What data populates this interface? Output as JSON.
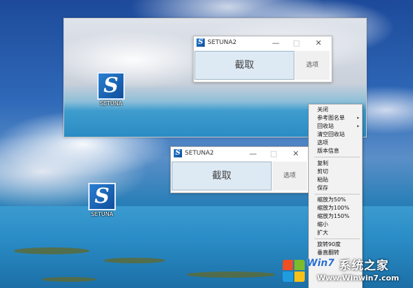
{
  "desktop_icons": [
    {
      "label": "SETUNA",
      "icon": "setuna-logo-icon"
    },
    {
      "label": "SETUNA",
      "icon": "setuna-logo-icon"
    }
  ],
  "windows": [
    {
      "title": "SETUNA2",
      "capture_label": "截取",
      "options_label": "选项",
      "minimize": "—",
      "maximize": "□",
      "close": "✕"
    },
    {
      "title": "SETUNA2",
      "capture_label": "截取",
      "options_label": "选项",
      "minimize": "—",
      "maximize": "□",
      "close": "✕"
    }
  ],
  "context_menu": {
    "items": [
      {
        "label": "关闭"
      },
      {
        "label": "参考图名单",
        "submenu": true
      },
      {
        "label": "回收站",
        "submenu": true
      },
      {
        "label": "清空回收站"
      },
      {
        "label": "选项"
      },
      {
        "label": "版本信息"
      },
      {
        "label": "复制"
      },
      {
        "label": "剪切"
      },
      {
        "label": "粘贴"
      },
      {
        "label": "保存"
      },
      {
        "label": "缩放为50%"
      },
      {
        "label": "缩放为100%"
      },
      {
        "label": "缩放为150%"
      },
      {
        "label": "缩小"
      },
      {
        "label": "扩大"
      },
      {
        "label": "旋转90度"
      },
      {
        "label": "垂直翻转"
      }
    ],
    "submenu_arrow": "▸"
  },
  "watermark": {
    "text": "系统之家",
    "brand": "Win7",
    "url": "Www.Winwin7.com"
  },
  "colors": {
    "capture_bg": "#dde9f3",
    "menu_bg": "#f2f2f2"
  }
}
